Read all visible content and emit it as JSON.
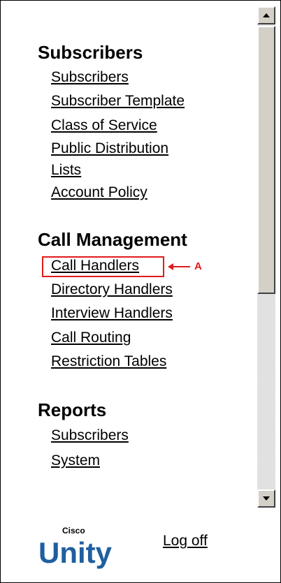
{
  "sections": [
    {
      "heading": "Subscribers",
      "links": [
        "Subscribers",
        "Subscriber Template",
        "Class of Service",
        "Public Distribution",
        "Lists",
        "Account Policy"
      ]
    },
    {
      "heading": "Call Management",
      "links": [
        "Call Handlers",
        "Directory Handlers",
        "Interview Handlers",
        "Call Routing",
        "Restriction Tables"
      ]
    },
    {
      "heading": "Reports",
      "links": [
        "Subscribers",
        "System"
      ]
    }
  ],
  "callout": {
    "label": "A",
    "color": "#e01b1b"
  },
  "footer": {
    "brand_small": "Cisco",
    "brand_big": "Unity",
    "brand_color": "#1f5fa0",
    "logoff_label": "Log off"
  }
}
